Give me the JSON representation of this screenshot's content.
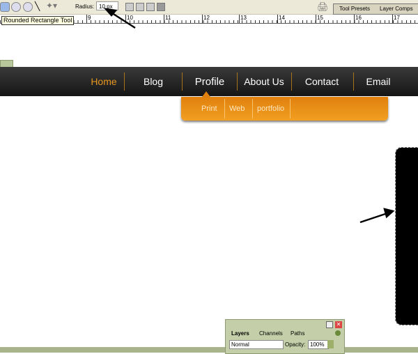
{
  "toolbar": {
    "radius_label": "Radius:",
    "radius_value": "10 px",
    "tooltip": "Rounded Rectangle Tool",
    "tabs": [
      "Tool Presets",
      "Layer Comps"
    ]
  },
  "ruler": {
    "ticks": [
      "9",
      "10",
      "11",
      "12",
      "13",
      "14",
      "15",
      "16",
      "17"
    ]
  },
  "nav": {
    "items": [
      "Home",
      "Blog",
      "Profile",
      "About Us",
      "Contact",
      "Email"
    ],
    "active": "Home",
    "active_color": "#e8961e"
  },
  "submenu": {
    "items": [
      "Print",
      "Web",
      "portfolio"
    ],
    "color": "#e8891a"
  },
  "layers_panel": {
    "tabs": [
      "Layers",
      "Channels",
      "Paths"
    ],
    "blend_mode": "Normal",
    "opacity_label": "Opacity:",
    "opacity_value": "100%"
  }
}
